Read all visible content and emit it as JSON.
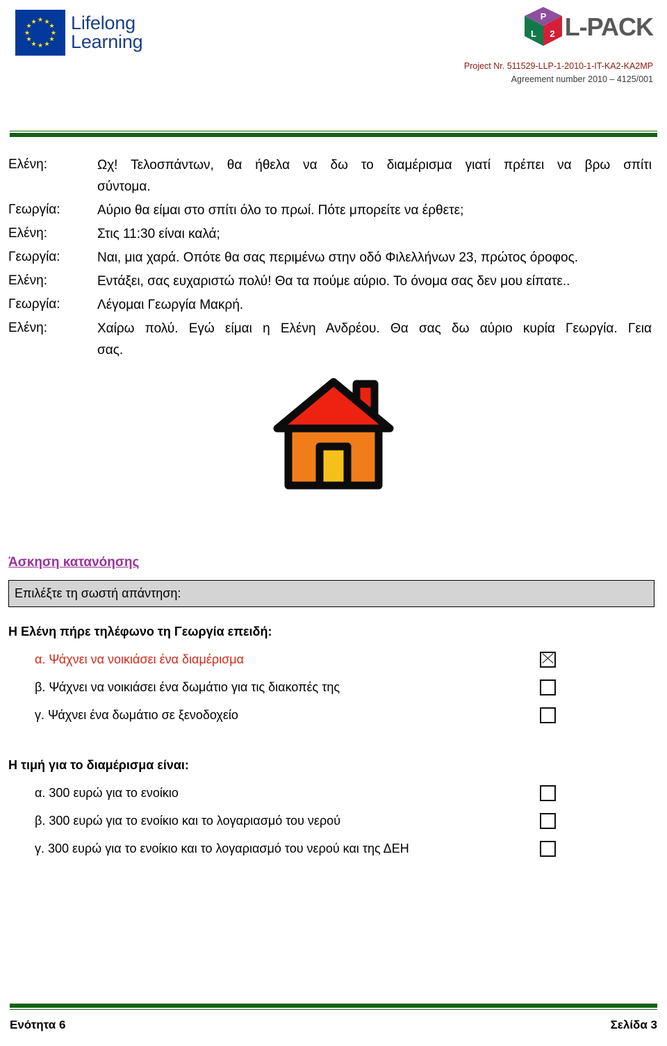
{
  "header": {
    "eu_logo": {
      "line1": "Lifelong",
      "line2": "Learning",
      "alt": "eu-lifelong-learning-logo"
    },
    "lpack_logo": {
      "cube_top_letter": "P",
      "cube_left_letter": "L",
      "cube_right_letter": "2",
      "wordmark": "L-PACK",
      "colors": {
        "top": "#8d4f9e",
        "left": "#12794a",
        "right": "#d51f36",
        "wordmark": "#595959"
      }
    },
    "project_nr": "Project Nr. 511529-LLP-1-2010-1-IT-KA2-KA2MP",
    "agreement": "Agreement number 2010 – 4125/001"
  },
  "rule_color": "#126312",
  "dialogue": [
    {
      "speaker": "Ελένη:",
      "text": "Ωχ! Τελοσπάντων, θα ήθελα να δω το διαμέρισμα γιατί πρέπει να βρω σπίτι",
      "tail": "σύντομα.",
      "justified": true
    },
    {
      "speaker": "Γεωργία:",
      "text": "Αύριο θα είμαι στο σπίτι όλο το πρωί. Πότε μπορείτε να έρθετε;",
      "tail": "",
      "justified": false
    },
    {
      "speaker": "Ελένη:",
      "text": "Στις 11:30 είναι καλά;",
      "tail": "",
      "justified": false
    },
    {
      "speaker": "Γεωργία:",
      "text": "Ναι, μια χαρά. Οπότε θα σας περιμένω στην οδό Φιλελλήνων 23, πρώτος όροφος.",
      "tail": "",
      "justified": false
    },
    {
      "speaker": "Ελένη:",
      "text": "Εντάξει, σας ευχαριστώ πολύ! Θα τα πούμε αύριο. Το όνομα σας δεν μου είπατε..",
      "tail": "",
      "justified": false
    },
    {
      "speaker": "Γεωργία:",
      "text": "Λέγομαι Γεωργία Μακρή.",
      "tail": "",
      "justified": false
    },
    {
      "speaker": "Ελένη:",
      "text": "Χαίρω πολύ. Εγώ είμαι η Ελένη Ανδρέου. Θα σας δω αύριο κυρία Γεωργία. Γεια",
      "tail": "σας.",
      "justified": true
    }
  ],
  "illustration": {
    "name": "house-illustration",
    "roof_color": "#ee2211",
    "wall_color": "#f07d19",
    "door_color": "#f5c01a",
    "outline_color": "#0b0b0b"
  },
  "exercise": {
    "title": "Άσκηση κατανόησης",
    "title_color": "#993399",
    "instruction": "Επιλέξτε τη σωστή απάντηση:",
    "questions": [
      {
        "prompt": "Η Ελένη πήρε τηλέφωνο τη Γεωργία επειδή:",
        "options": [
          {
            "label": "α. Ψάχνει να νοικιάσει ένα διαμέρισμα",
            "checked": true,
            "highlight": true
          },
          {
            "label": "β. Ψάχνει να νοικιάσει ένα δωμάτιο για τις διακοπές της",
            "checked": false,
            "highlight": false
          },
          {
            "label": "γ.  Ψάχνει ένα δωμάτιο σε ξενοδοχείο",
            "checked": false,
            "highlight": false
          }
        ]
      },
      {
        "prompt": "Η τιμή για το διαμέρισμα είναι:",
        "options": [
          {
            "label": "α. 300 ευρώ για το ενοίκιο",
            "checked": false,
            "highlight": false
          },
          {
            "label": "β. 300 ευρώ για το ενοίκιο και το λογαριασμό του νερού",
            "checked": false,
            "highlight": false
          },
          {
            "label": "γ.  300 ευρώ για το ενοίκιο και το λογαριασμό του νερού και της ΔΕΗ",
            "checked": false,
            "highlight": false
          }
        ]
      }
    ]
  },
  "footer": {
    "left": "Ενότητα 6",
    "right": "Σελίδα 3"
  }
}
